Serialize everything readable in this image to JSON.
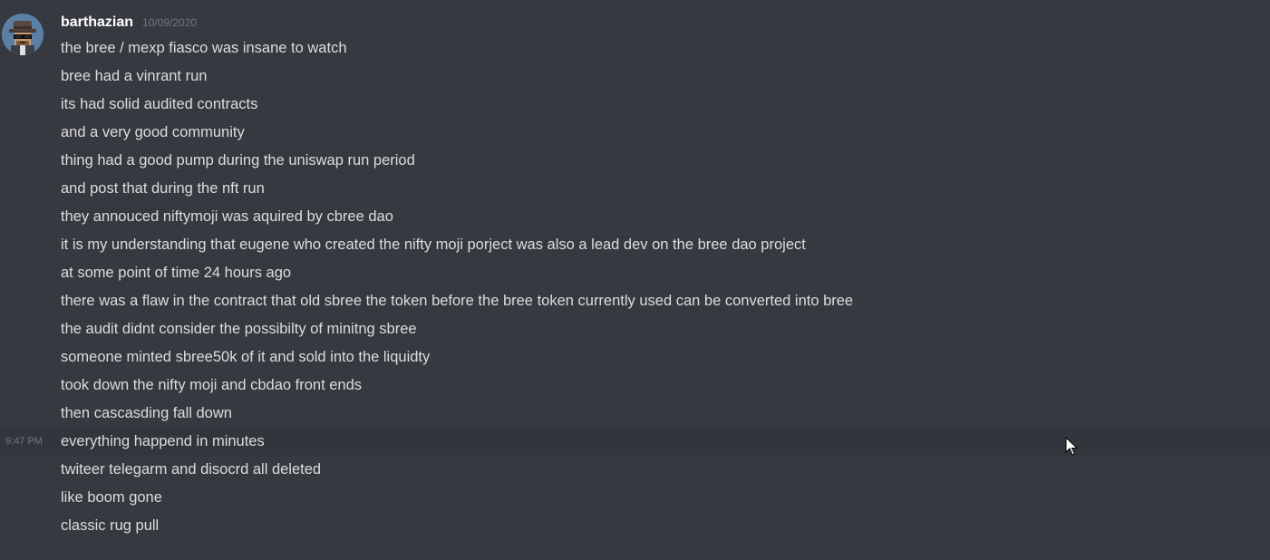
{
  "message": {
    "author": "barthazian",
    "date": "10/09/2020",
    "avatar_icon": "detective-avatar-icon",
    "hover_time": "9:47 PM",
    "lines": [
      "the bree / mexp fiasco was insane to watch",
      "bree had a vinrant run",
      "its had solid audited contracts",
      "and a very good community",
      "thing had a good pump during the uniswap run period",
      "and post that during the nft run",
      "they annouced niftymoji was aquired by cbree dao",
      "it is my understanding that eugene who created the nifty moji porject was also a lead dev on the bree dao project",
      "at some point of time 24 hours ago",
      "there was a flaw in the contract that old sbree the token before the bree token currently used can be converted into bree",
      "the audit didnt consider the possibilty of minitng sbree",
      "someone minted sbree50k of it and sold into the liquidty",
      "took down the nifty moji and cbdao front ends",
      "then cascasding fall down",
      "everything happend in minutes",
      "twiteer telegarm and disocrd all deleted",
      "like boom gone",
      "classic rug pull"
    ]
  },
  "colors": {
    "background": "#36393f",
    "hover_background": "#32353b",
    "text": "#dcddde",
    "username": "#ffffff",
    "muted": "#72767d"
  }
}
